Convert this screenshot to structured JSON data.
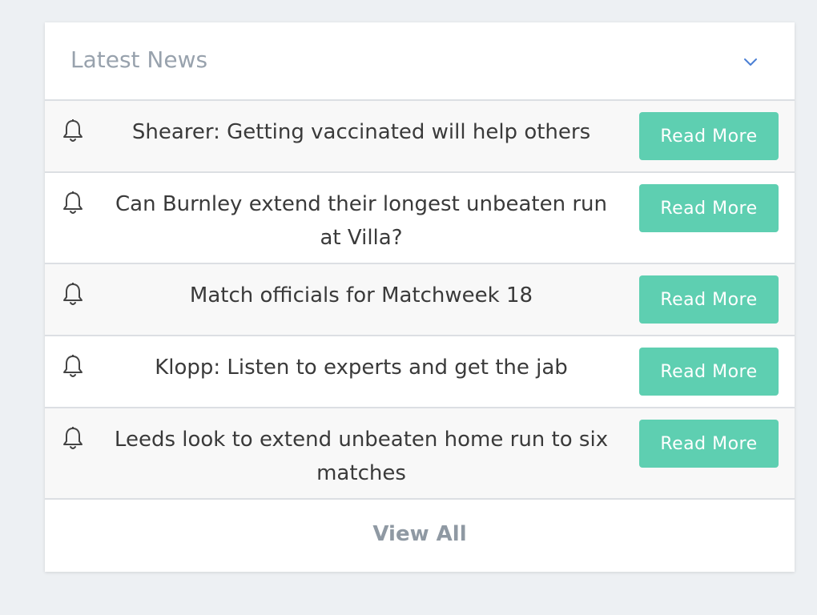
{
  "panel": {
    "title": "Latest News",
    "collapse_icon": "chevron-down-icon",
    "accent_color": "#4a7fd4"
  },
  "news": [
    {
      "headline": "Shearer: Getting vaccinated will help others",
      "button": "Read More",
      "icon": "bell-icon"
    },
    {
      "headline": "Can Burnley extend their longest unbeaten run at Villa?",
      "button": "Read More",
      "icon": "bell-icon"
    },
    {
      "headline": "Match officials for Matchweek 18",
      "button": "Read More",
      "icon": "bell-icon"
    },
    {
      "headline": "Klopp: Listen to experts and get the jab",
      "button": "Read More",
      "icon": "bell-icon"
    },
    {
      "headline": "Leeds look to extend unbeaten home run to six matches",
      "button": "Read More",
      "icon": "bell-icon"
    }
  ],
  "footer": {
    "view_all_label": "View All"
  },
  "colors": {
    "button_bg": "#5ecfb1",
    "button_text": "#ffffff",
    "page_bg": "#edf0f3"
  }
}
